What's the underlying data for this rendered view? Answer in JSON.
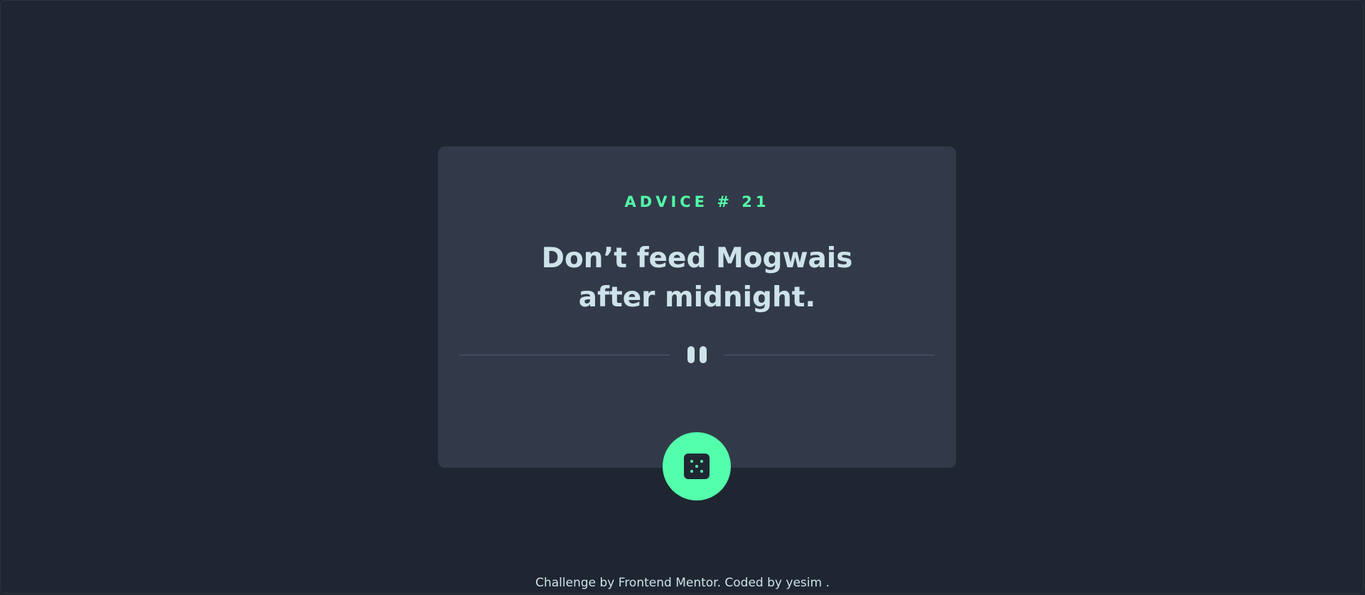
{
  "card": {
    "advice_id": "ADVICE # 21",
    "advice_text": "Don’t feed Mogwais after midnight."
  },
  "divider": {
    "icon": "pause-icon"
  },
  "dice_button": {
    "icon": "dice-icon"
  },
  "footer": {
    "text": "Challenge by Frontend Mentor. Coded by yesim ."
  },
  "colors": {
    "background": "#1f2631",
    "card": "#323a49",
    "accent": "#53ffaa",
    "text": "#cee3e9",
    "divider": "#4f5d74"
  }
}
